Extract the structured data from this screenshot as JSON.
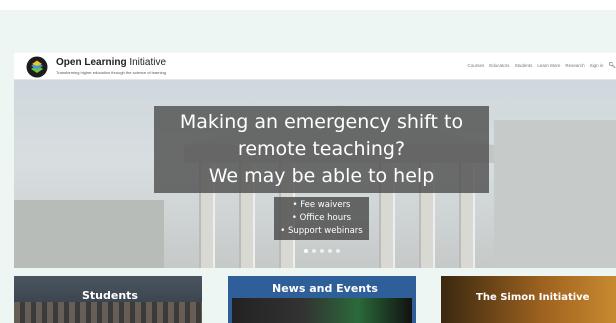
{
  "header": {
    "brand_bold": "Open Learning",
    "brand_rest": " Initiative",
    "tagline": "Transforming higher education through the science of learning",
    "nav": [
      "Courses",
      "Educators",
      "Students",
      "Learn More",
      "Research",
      "Sign in"
    ],
    "search_icon": "search-icon"
  },
  "hero": {
    "lines": [
      "Making an emergency shift to",
      "remote teaching?",
      "We may be able to help"
    ],
    "bullets": [
      "• Fee waivers",
      "• Office hours",
      "• Support webinars"
    ],
    "slide_count": 5,
    "active_slide": 1
  },
  "tiles": {
    "students": "Students",
    "news": "News and Events",
    "simon": "The Simon Initiative"
  },
  "colors": {
    "news_tile": "#2e5f99",
    "page_bg": "#eef6f4"
  }
}
